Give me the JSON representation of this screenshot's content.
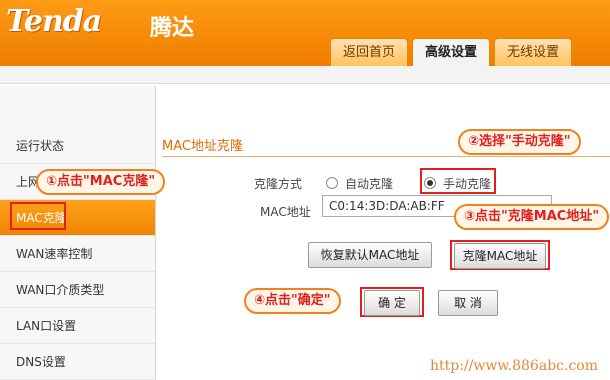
{
  "header": {
    "logo": "Tenda",
    "logo_cn": "腾达",
    "tabs": [
      {
        "label": "返回首页",
        "active": false
      },
      {
        "label": "高级设置",
        "active": true
      },
      {
        "label": "无线设置",
        "active": false
      }
    ]
  },
  "sidebar": {
    "items": [
      {
        "label": "运行状态",
        "active": false
      },
      {
        "label": "上网",
        "active": false
      },
      {
        "label": "MAC克隆",
        "active": true
      },
      {
        "label": "WAN速率控制",
        "active": false
      },
      {
        "label": "WAN口介质类型",
        "active": false
      },
      {
        "label": "LAN口设置",
        "active": false
      },
      {
        "label": "DNS设置",
        "active": false
      }
    ]
  },
  "main": {
    "title": "MAC地址克隆",
    "clone_mode_label": "克隆方式",
    "auto_clone_label": "自动克隆",
    "manual_clone_label": "手动克隆",
    "selected_mode": "手动克隆",
    "mac_label": "MAC地址",
    "mac_value": "C0:14:3D:DA:AB:FF",
    "restore_button": "恢复默认MAC地址",
    "clone_button": "克隆MAC地址",
    "ok_button": "确 定",
    "cancel_button": "取 消"
  },
  "callouts": {
    "step1": "①点击\"MAC克隆\"",
    "step2": "②选择\"手动克隆\"",
    "step3": "③点击\"克隆MAC地址\"",
    "step4": "④点击\"确定\""
  },
  "colors": {
    "brand_orange": "#f08400",
    "highlight_red": "#e0201c"
  },
  "watermark": "http://www.886abc.com"
}
